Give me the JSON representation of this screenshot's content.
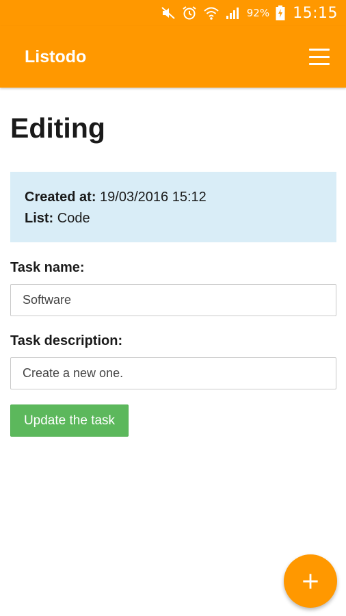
{
  "status_bar": {
    "icons": [
      "muted-icon",
      "alarm-icon",
      "wifi-icon",
      "signal-icon",
      "battery-icon"
    ],
    "battery_percent": "92%",
    "time": "15:15"
  },
  "app_bar": {
    "title": "Listodo",
    "menu_icon": "hamburger-menu-icon"
  },
  "page": {
    "title": "Editing"
  },
  "info": {
    "created_label": "Created at:",
    "created_value": "19/03/2016 15:12",
    "list_label": "List:",
    "list_value": "Code"
  },
  "form": {
    "task_name_label": "Task name:",
    "task_name_value": "Software",
    "task_description_label": "Task description:",
    "task_description_value": "Create a new one.",
    "update_button_label": "Update the task"
  },
  "fab": {
    "icon": "plus-icon",
    "label": "+"
  },
  "colors": {
    "accent": "#ff9800",
    "info_background": "#d9edf7",
    "success_button": "#5cb85c"
  }
}
